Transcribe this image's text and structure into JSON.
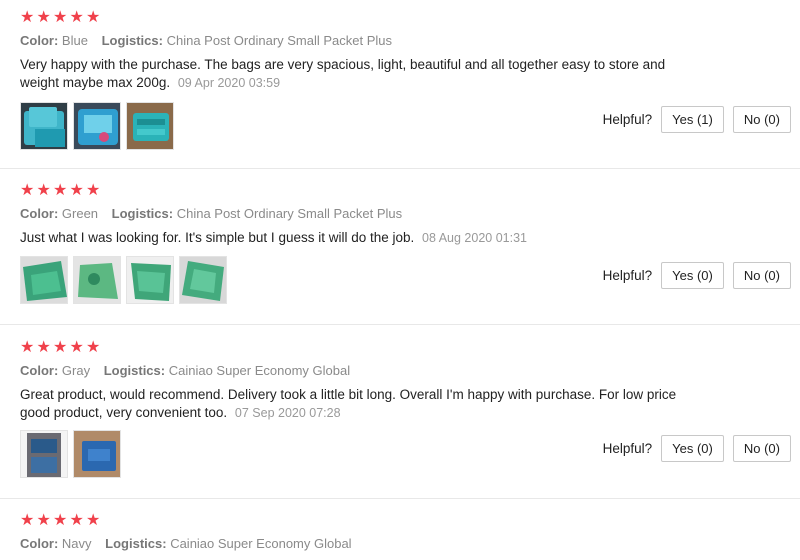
{
  "labels": {
    "color": "Color:",
    "logistics": "Logistics:",
    "helpful": "Helpful?"
  },
  "colors": {
    "star": "#f0414b",
    "meta": "#8a8a8a",
    "date": "#999999"
  },
  "reviews": [
    {
      "rating": 5,
      "color": "Blue",
      "logistics": "China Post Ordinary Small Packet Plus",
      "text": "Very happy with the purchase. The bags are very spacious, light, beautiful and all together easy to store and weight maybe max 200g.",
      "date": "09 Apr 2020 03:59",
      "yes": "Yes (1)",
      "no": "No (0)",
      "photos": 3
    },
    {
      "rating": 5,
      "color": "Green",
      "logistics": "China Post Ordinary Small Packet Plus",
      "text": "Just what I was looking for. It's simple but I guess it will do the job.",
      "date": "08 Aug 2020 01:31",
      "yes": "Yes (0)",
      "no": "No (0)",
      "photos": 4
    },
    {
      "rating": 5,
      "color": "Gray",
      "logistics": "Cainiao Super Economy Global",
      "text": "Great product, would recommend. Delivery took a little bit long. Overall I'm happy with purchase. For low price good product, very convenient too.",
      "date": "07 Sep 2020 07:28",
      "yes": "Yes (0)",
      "no": "No (0)",
      "photos": 2
    },
    {
      "rating": 5,
      "color": "Navy",
      "logistics": "Cainiao Super Economy Global"
    }
  ]
}
